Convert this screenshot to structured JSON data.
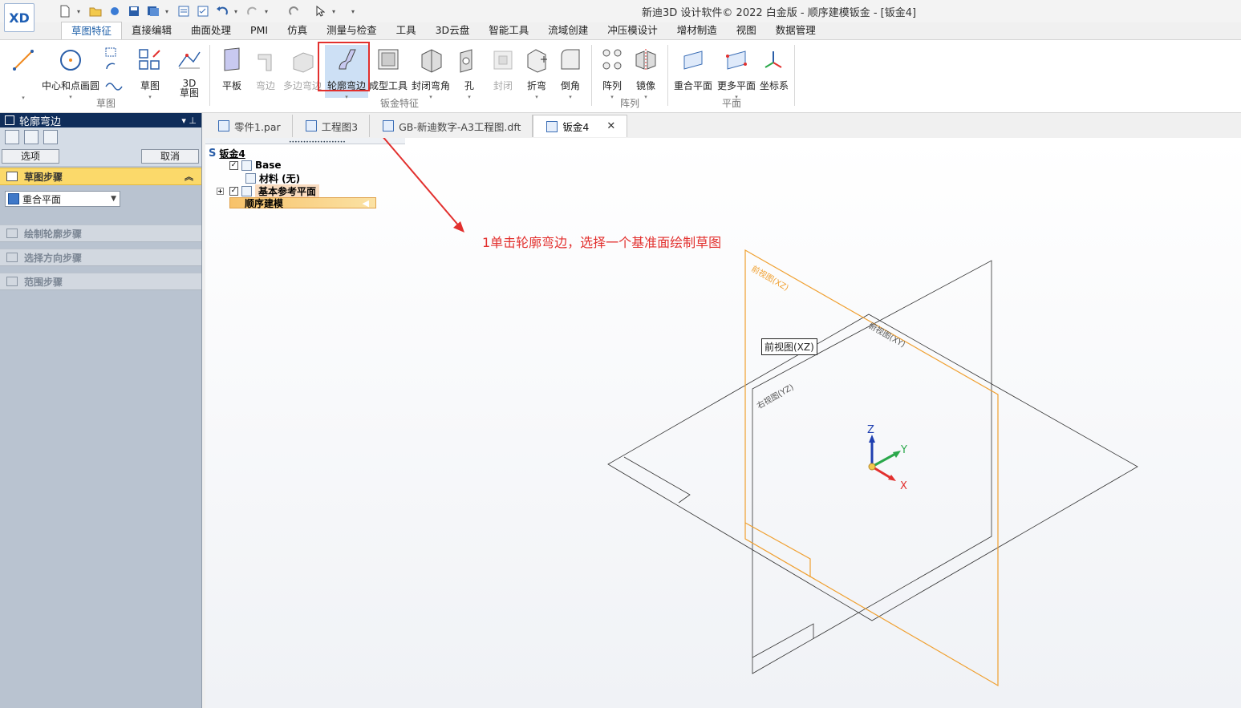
{
  "window_title": "新迪3D 设计软件© 2022 白金版 - 顺序建模钣金 - [钣金4]",
  "app_logo": "XD",
  "tabs": [
    "草图特征",
    "直接编辑",
    "曲面处理",
    "PMI",
    "仿真",
    "测量与检查",
    "工具",
    "3D云盘",
    "智能工具",
    "流域创建",
    "冲压模设计",
    "增材制造",
    "视图",
    "数据管理"
  ],
  "ribbon": {
    "sketch": {
      "line": "",
      "center_circle": "中心和点画圆",
      "sketch": "草图",
      "sketch3d": "3D\n草图",
      "group": "草图"
    },
    "sheetmetal": {
      "tab": "平板",
      "flange": "弯边",
      "multi_flange": "多边弯边",
      "contour_flange": "轮廓弯边",
      "form_tool": "成型工具",
      "closed_corner": "封闭弯角",
      "hole": "孔",
      "close": "封闭",
      "bend": "折弯",
      "chamfer": "倒角",
      "group": "钣金特征"
    },
    "pattern": {
      "array": "阵列",
      "mirror": "镜像",
      "group": "阵列"
    },
    "plane": {
      "coincident_plane": "重合平面",
      "more_planes": "更多平面",
      "coordinate_system": "坐标系",
      "group": "平面"
    }
  },
  "left_panel": {
    "title": "轮廓弯边",
    "options_button": "选项",
    "cancel_button": "取消",
    "steps": [
      {
        "label": "草图步骤",
        "active": true
      },
      {
        "label": "绘制轮廓步骤",
        "active": false
      },
      {
        "label": "选择方向步骤",
        "active": false
      },
      {
        "label": "范围步骤",
        "active": false
      }
    ],
    "plane_select": "重合平面"
  },
  "doc_tabs": [
    {
      "label": "零件1.par",
      "active": false
    },
    {
      "label": "工程图3",
      "active": false
    },
    {
      "label": "GB-新迪数字-A3工程图.dft",
      "active": false
    },
    {
      "label": "钣金4",
      "active": true
    }
  ],
  "tree": {
    "root": "钣金4",
    "base": "Base",
    "material": "材料 (无)",
    "ref_planes": "基本参考平面",
    "sequential": "顺序建模"
  },
  "annotation": "1单击轮廓弯边，选择一个基准面绘制草图",
  "tooltip": "前视图(XZ)",
  "viewport": {
    "front_plane_label": "前视图(XZ)",
    "right_plane_label": "右视图(YZ)",
    "top_plane_label": "俯视图(XY)",
    "axis_x": "X",
    "axis_y": "Y",
    "axis_z": "Z"
  },
  "colors": {
    "accent": "#e2302e",
    "front_plane": "#f0a030",
    "panel_title": "#0f2d5a",
    "active_step": "#fbd96a"
  }
}
